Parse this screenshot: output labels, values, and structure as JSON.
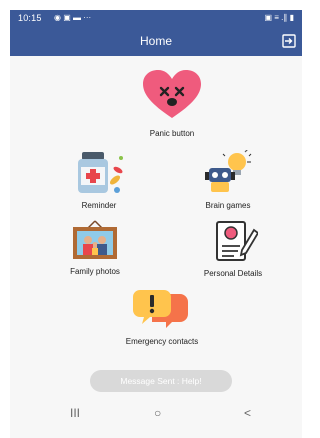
{
  "status_bar": {
    "time": "10:15",
    "left_icons": "◉ ▣ ▬ ···",
    "right_icons": "▣ ≡ .∥ ▮"
  },
  "app_bar": {
    "title": "Home"
  },
  "tiles": {
    "panic": {
      "label": "Panic button"
    },
    "reminder": {
      "label": "Reminder"
    },
    "brain_games": {
      "label": "Brain games"
    },
    "family_photos": {
      "label": "Family photos"
    },
    "personal_details": {
      "label": "Personal Details"
    },
    "emergency_contacts": {
      "label": "Emergency contacts"
    }
  },
  "toast": {
    "text": "Message Sent : Help!"
  },
  "nav_bar": {
    "recents": "III",
    "home": "○",
    "back": "<"
  }
}
